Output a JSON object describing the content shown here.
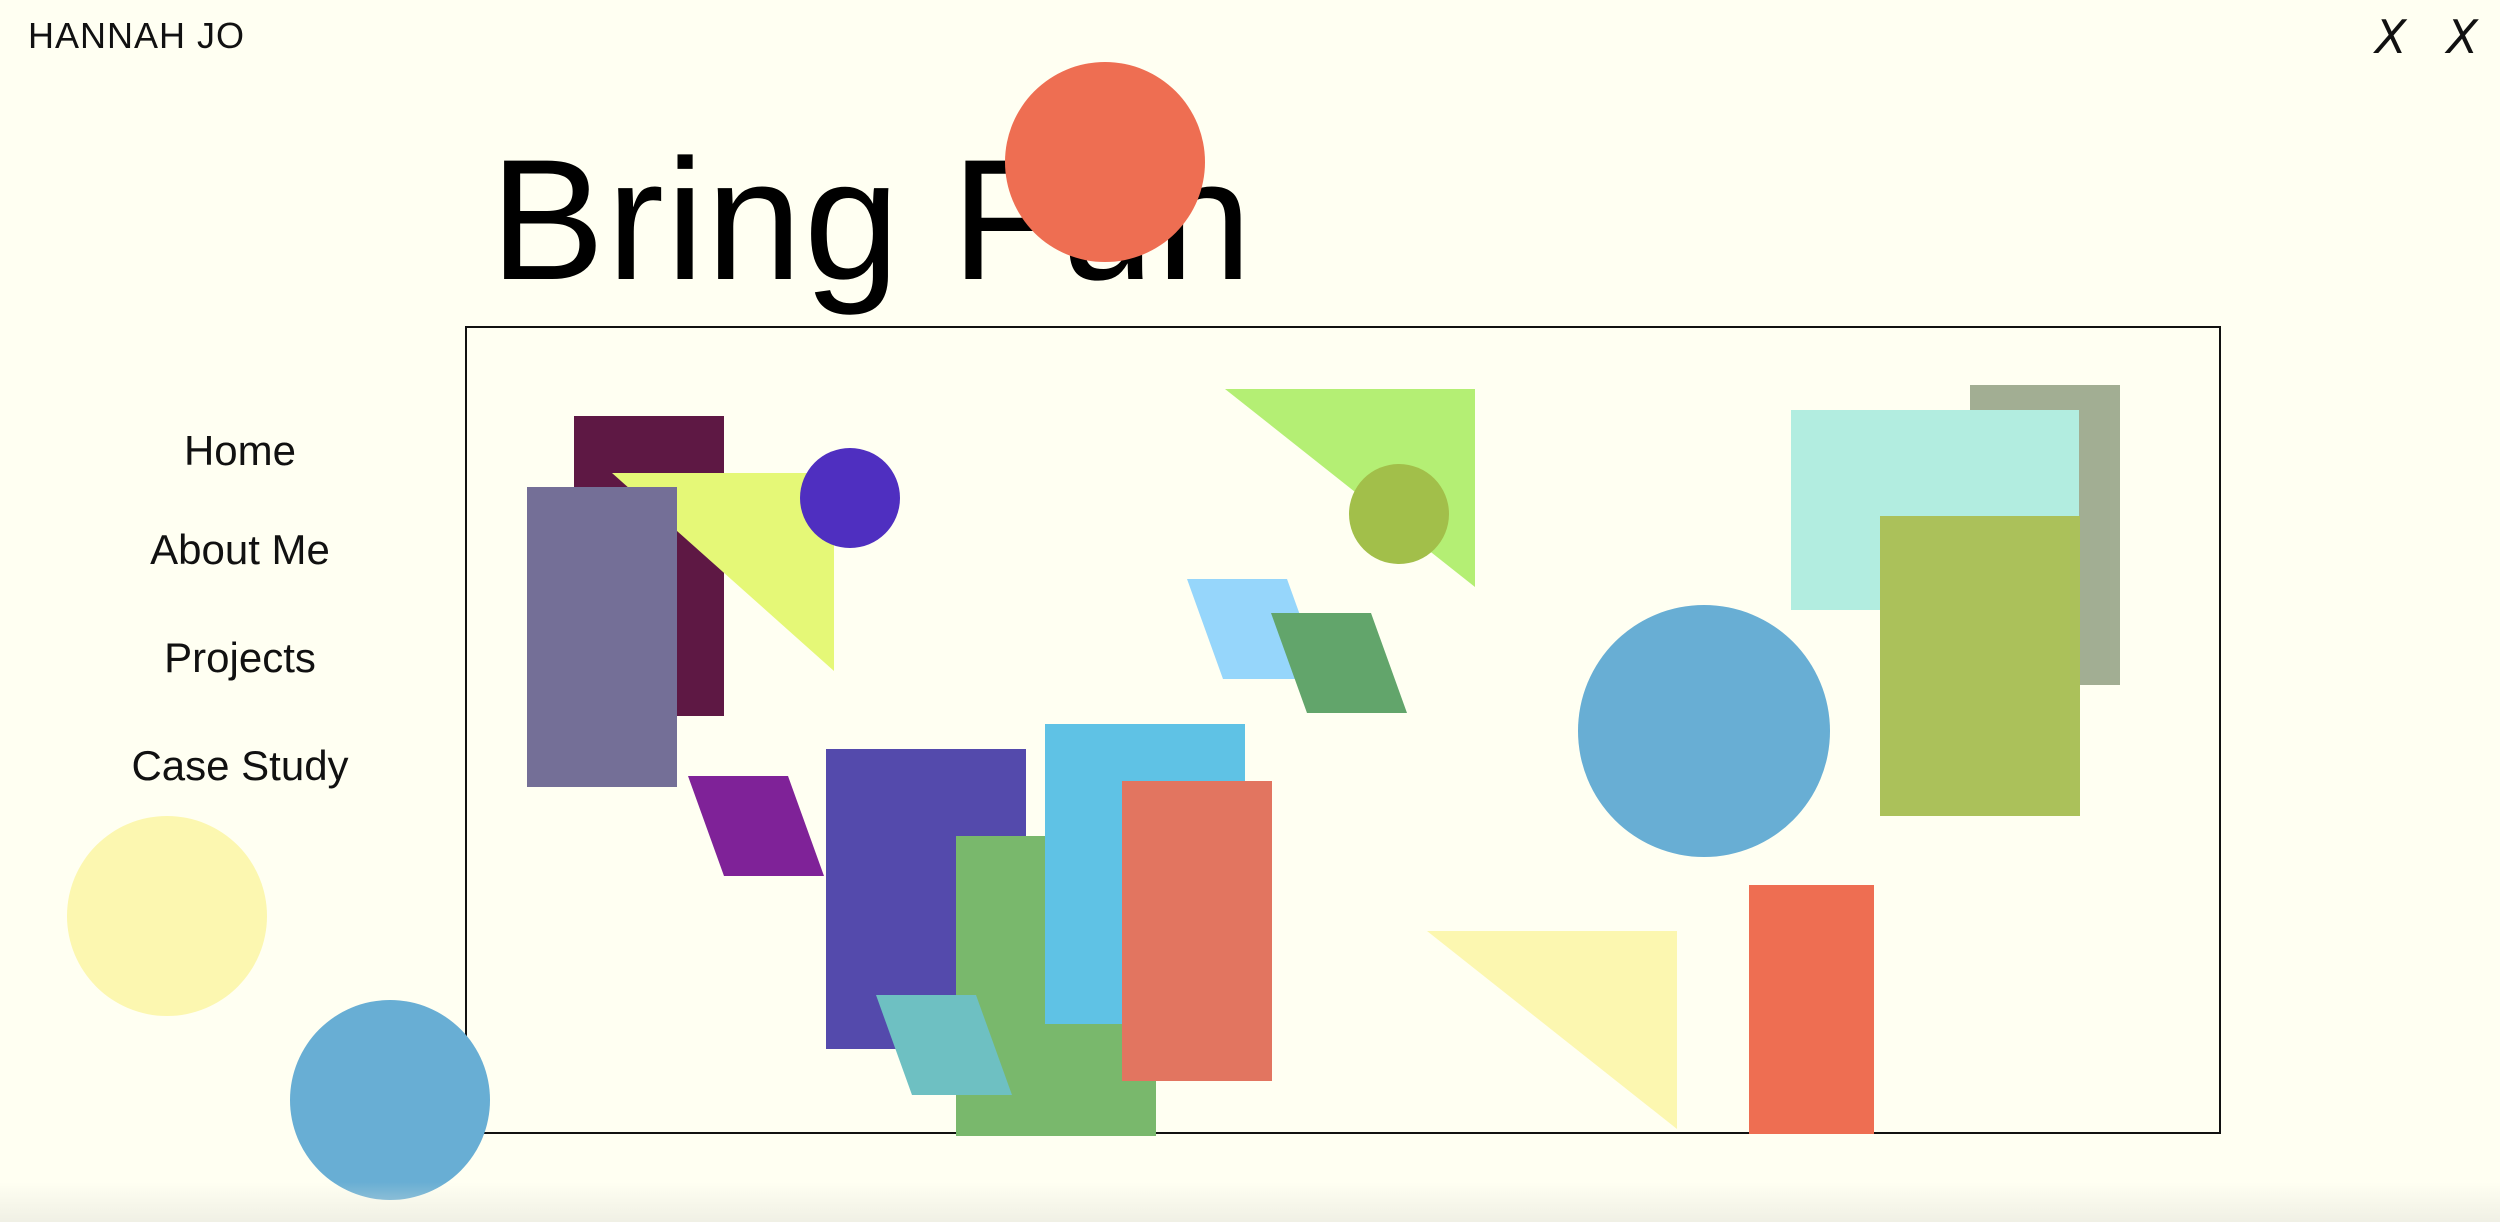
{
  "brand": {
    "name": "HANNAH JO"
  },
  "header": {
    "close_buttons": [
      "X",
      "X"
    ]
  },
  "hero": {
    "title": "Bring Fun"
  },
  "nav": {
    "items": [
      {
        "label": "Home"
      },
      {
        "label": "About Me"
      },
      {
        "label": "Projects"
      },
      {
        "label": "Case Study"
      }
    ]
  },
  "colors": {
    "background": "#fffff2",
    "coral": "#ee6e52",
    "pale_yellow": "#fcf7b0",
    "sky_blue": "#68aed4",
    "wine": "#5e1844",
    "slate_purple": "#746f97",
    "lime": "#e5f877",
    "indigo": "#4f2fc0",
    "light_green": "#b4ef74",
    "olive": "#a2bf4a",
    "baby_blue": "#96d6fb",
    "forest": "#62a56b",
    "mint": "#b2ede0",
    "sage": "#a2ae93",
    "moss": "#abc15a",
    "purple": "#7f2298",
    "blue_violet": "#544aac",
    "cyan": "#5fc2e5",
    "grass": "#79b86c",
    "salmon": "#e27560",
    "teal": "#6ec0c2"
  }
}
